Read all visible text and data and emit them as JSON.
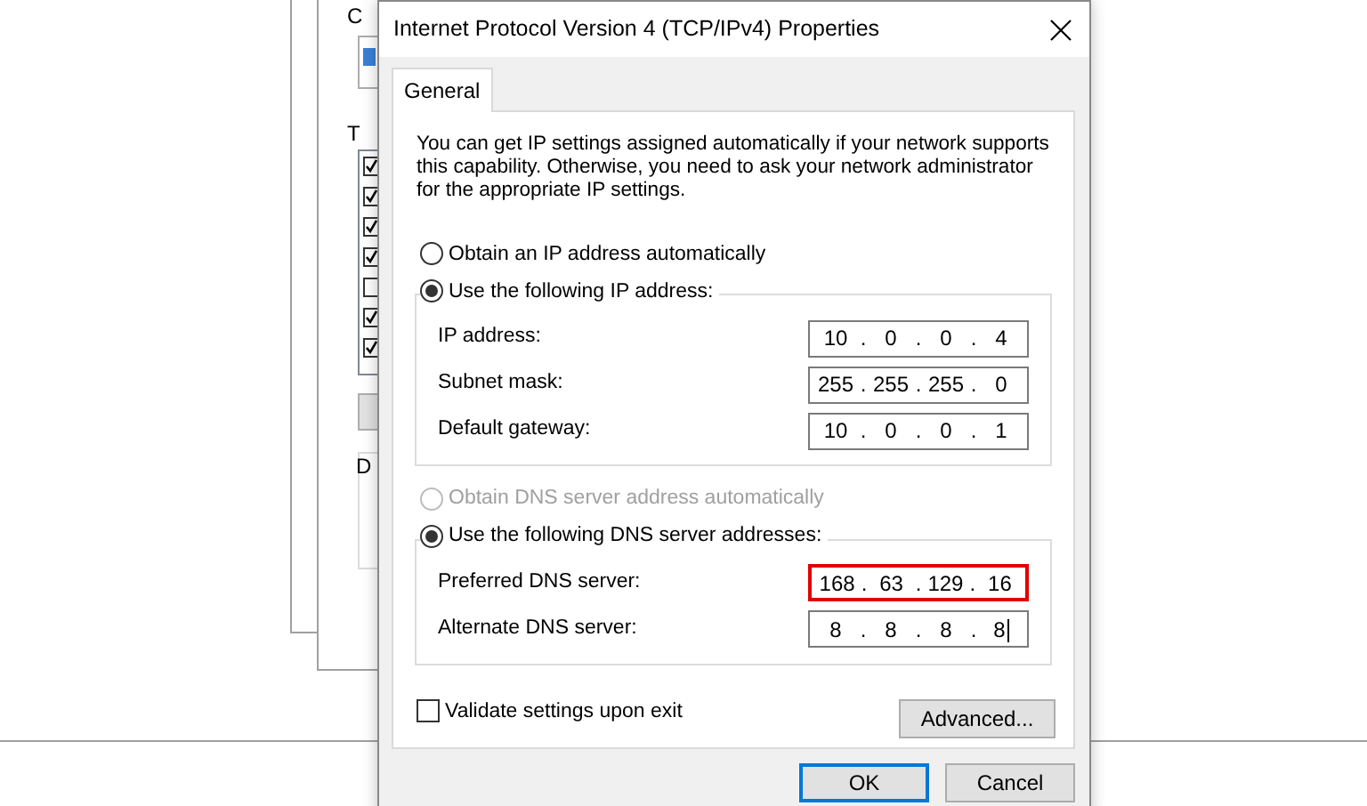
{
  "behind_window": {
    "texts": [
      "C",
      "T",
      "D"
    ],
    "list_checks": [
      true,
      true,
      true,
      true,
      false,
      true,
      true
    ]
  },
  "dialog": {
    "title": "Internet Protocol Version 4 (TCP/IPv4) Properties",
    "tabs": [
      {
        "label": "General",
        "selected": true
      }
    ],
    "description": "You can get IP settings assigned automatically if your network supports this capability. Otherwise, you need to ask your network administrator for the appropriate IP settings.",
    "ip_options": [
      {
        "label": "Obtain an IP address automatically",
        "selected": false,
        "disabled": false
      },
      {
        "label": "Use the following IP address:",
        "selected": true,
        "disabled": false
      }
    ],
    "ip_fields": [
      {
        "label": "IP address:",
        "octets": [
          "10",
          "0",
          "0",
          "4"
        ],
        "separators": [
          ".",
          ".",
          "."
        ],
        "highlighted": false,
        "focused": false
      },
      {
        "label": "Subnet mask:",
        "octets": [
          "255",
          "255",
          "255",
          "0"
        ],
        "separators": [
          ".",
          ".",
          "."
        ],
        "highlighted": false,
        "focused": false
      },
      {
        "label": "Default gateway:",
        "octets": [
          "10",
          "0",
          "0",
          "1"
        ],
        "separators": [
          ".",
          ".",
          "."
        ],
        "highlighted": false,
        "focused": false
      }
    ],
    "dns_options": [
      {
        "label": "Obtain DNS server address automatically",
        "selected": false,
        "disabled": true
      },
      {
        "label": "Use the following DNS server addresses:",
        "selected": true,
        "disabled": false
      }
    ],
    "dns_fields": [
      {
        "label": "Preferred DNS server:",
        "octets": [
          "168",
          "63",
          "129",
          "16"
        ],
        "separators": [
          ".",
          ".",
          "."
        ],
        "highlighted": true,
        "focused": false
      },
      {
        "label": "Alternate DNS server:",
        "octets": [
          "8",
          "8",
          "8",
          "8"
        ],
        "separators": [
          ".",
          ".",
          "."
        ],
        "highlighted": false,
        "focused": true
      }
    ],
    "validate": {
      "label": "Validate settings upon exit",
      "checked": false
    },
    "advanced_button": "Advanced...",
    "buttons": [
      {
        "label": "OK",
        "default": true
      },
      {
        "label": "Cancel",
        "default": false
      }
    ]
  }
}
